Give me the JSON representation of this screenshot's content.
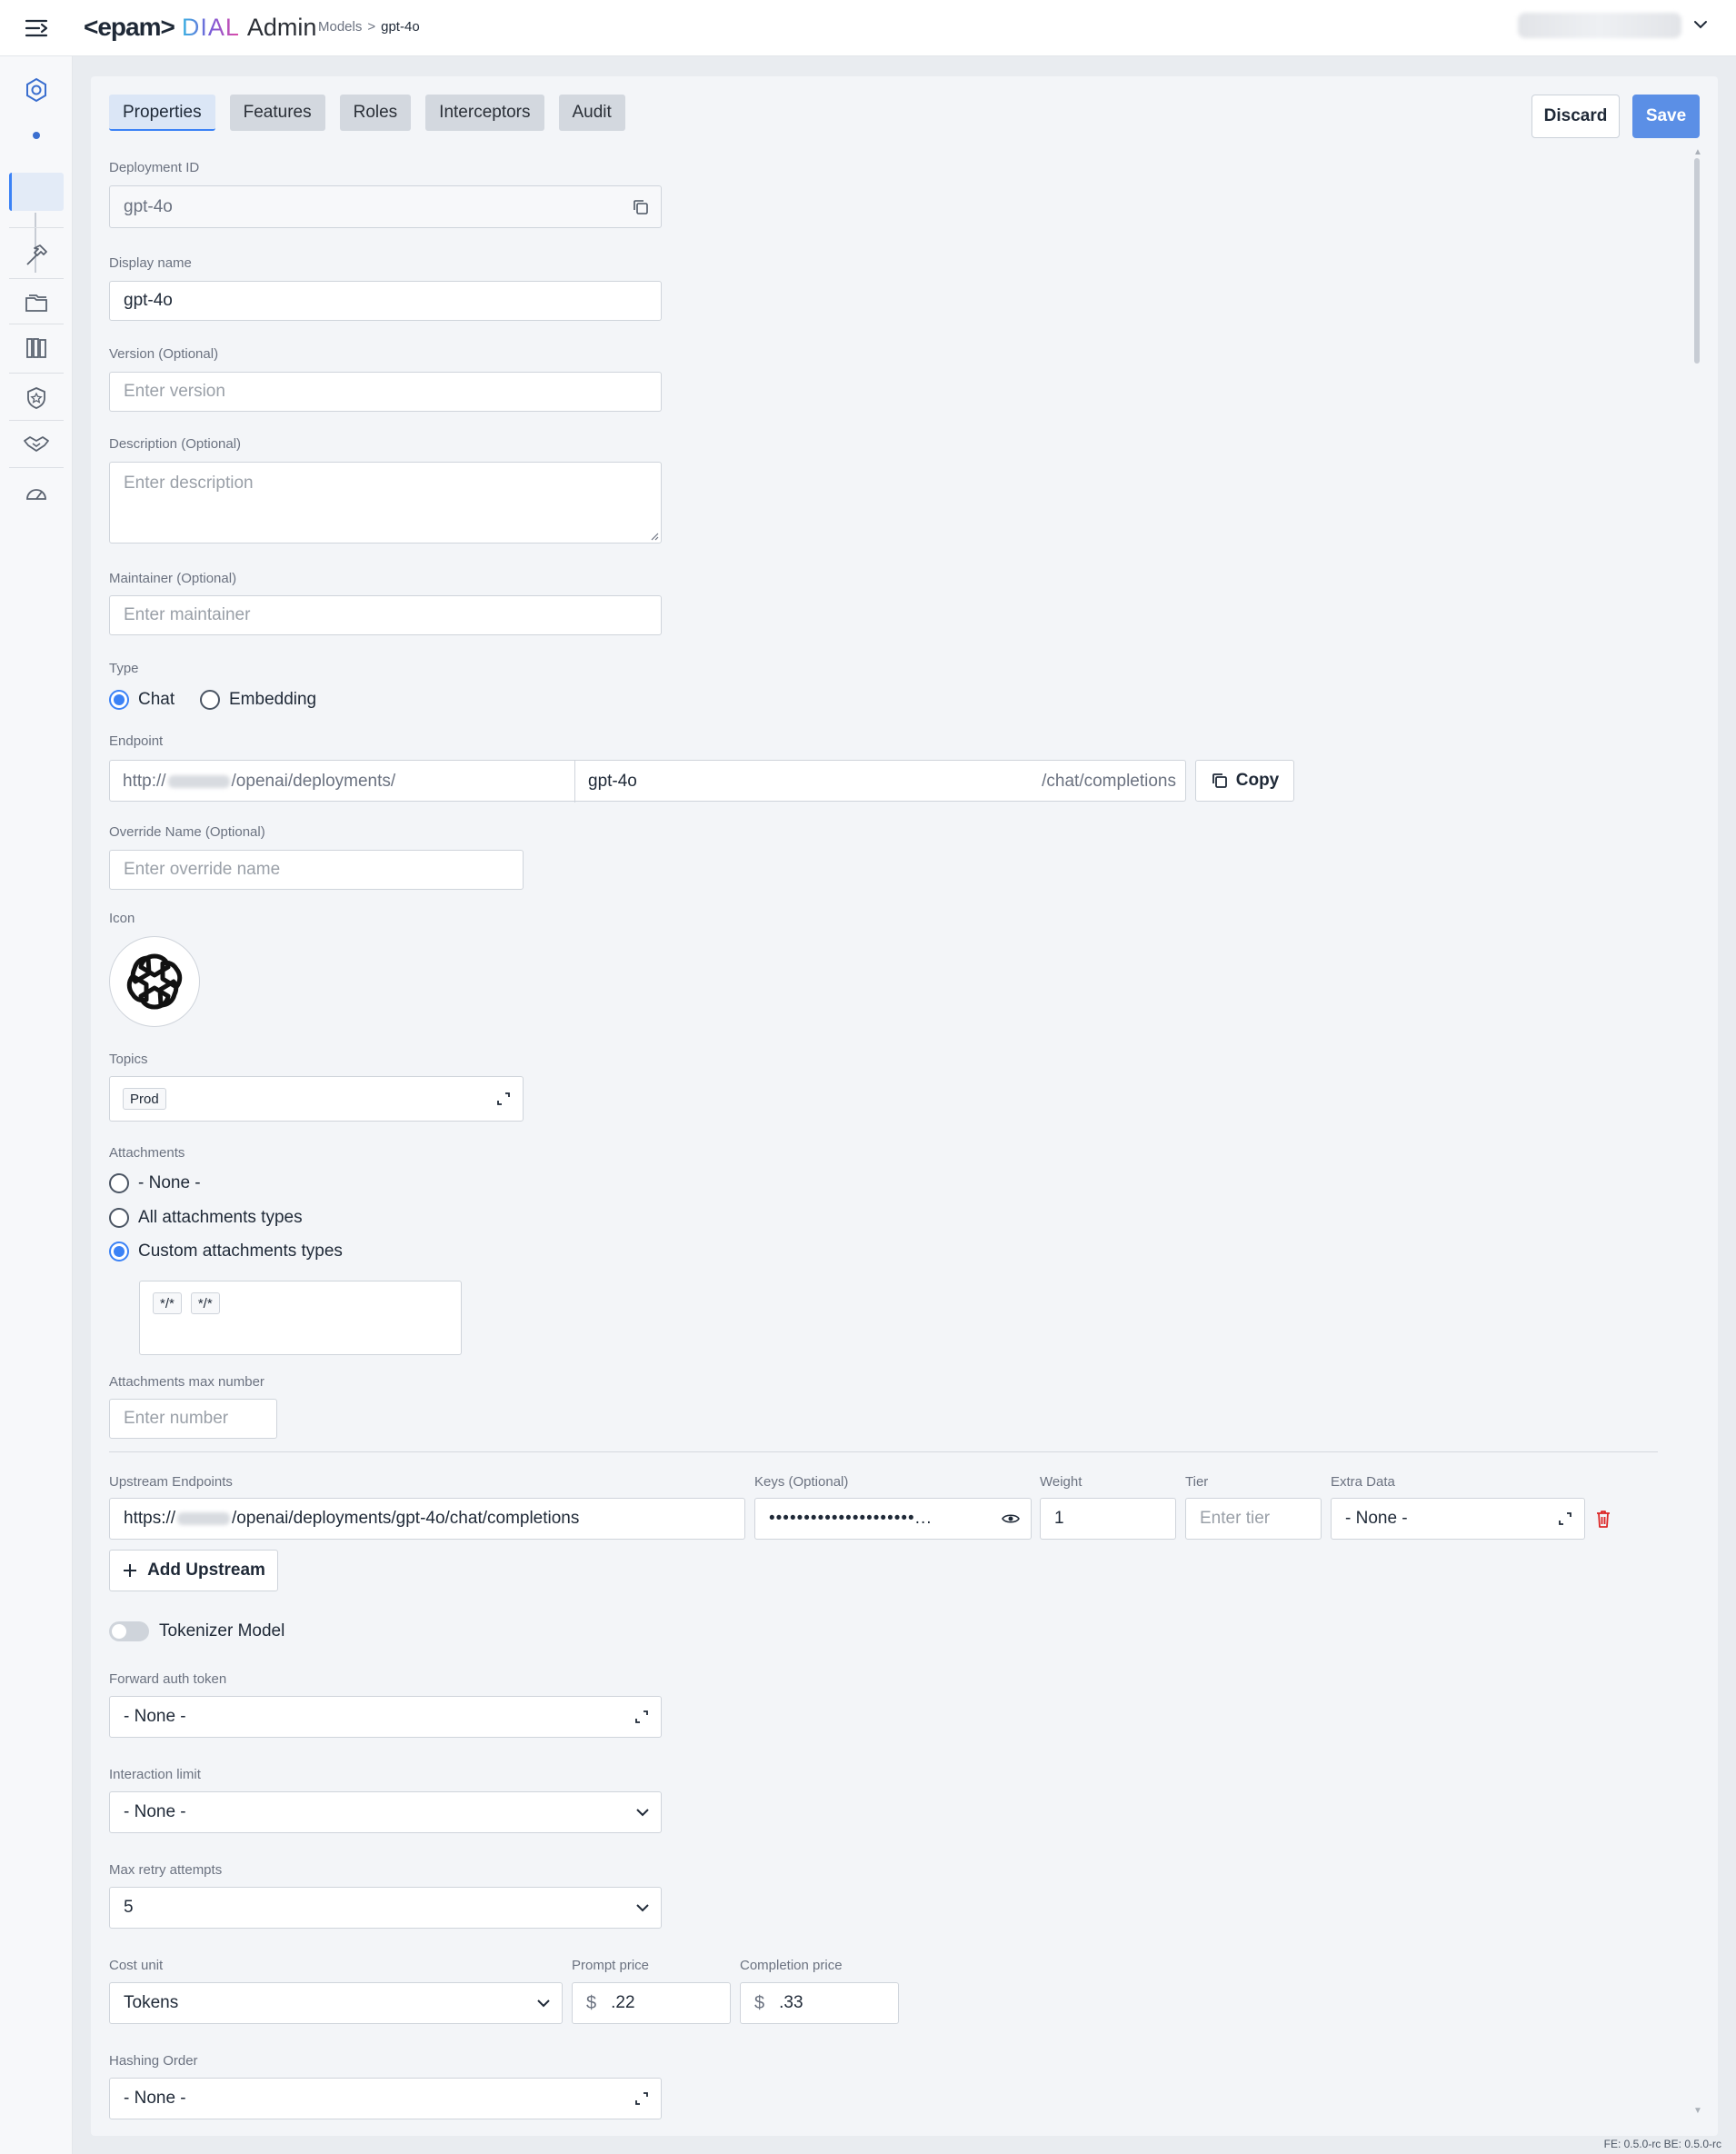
{
  "header": {
    "logo_epam": "<epam>",
    "logo_dial": "DIAL",
    "logo_admin": "Admin",
    "breadcrumb_parent": "Models",
    "breadcrumb_sep": ">",
    "breadcrumb_current": "gpt-4o"
  },
  "tabs": [
    {
      "label": "Properties"
    },
    {
      "label": "Features"
    },
    {
      "label": "Roles"
    },
    {
      "label": "Interceptors"
    },
    {
      "label": "Audit"
    }
  ],
  "actions": {
    "discard": "Discard",
    "save": "Save"
  },
  "form": {
    "deployment_id": {
      "label": "Deployment ID",
      "value": "gpt-4o"
    },
    "display_name": {
      "label": "Display name",
      "value": "gpt-4o"
    },
    "version": {
      "label": "Version (Optional)",
      "placeholder": "Enter version"
    },
    "description": {
      "label": "Description (Optional)",
      "placeholder": "Enter description"
    },
    "maintainer": {
      "label": "Maintainer (Optional)",
      "placeholder": "Enter maintainer"
    },
    "type": {
      "label": "Type",
      "options": [
        "Chat",
        "Embedding"
      ],
      "selected": "Chat"
    },
    "endpoint": {
      "label": "Endpoint",
      "prefix_start": "http://",
      "prefix_end": "/openai/deployments/",
      "model": "gpt-4o",
      "suffix": "/chat/completions",
      "copy_label": "Copy"
    },
    "override_name": {
      "label": "Override Name (Optional)",
      "placeholder": "Enter override name"
    },
    "icon": {
      "label": "Icon",
      "name": "openai-logo-icon"
    },
    "topics": {
      "label": "Topics",
      "chips": [
        "Prod"
      ]
    },
    "attachments": {
      "label": "Attachments",
      "options": [
        "- None -",
        "All attachments types",
        "Custom attachments types"
      ],
      "selected": "Custom attachments types",
      "custom_types": [
        "*/*",
        "*/*"
      ]
    },
    "attachments_max": {
      "label": "Attachments max number",
      "placeholder": "Enter number"
    },
    "upstream": {
      "headers": {
        "endpoints": "Upstream Endpoints",
        "keys": "Keys (Optional)",
        "weight": "Weight",
        "tier": "Tier",
        "extra": "Extra Data"
      },
      "rows": [
        {
          "url_start": "https://",
          "url_end": "/openai/deployments/gpt-4o/chat/completions",
          "key_mask": "•••••••••••••••••••••...",
          "weight": "1",
          "tier_placeholder": "Enter tier",
          "extra": "- None -"
        }
      ],
      "add_label": "Add Upstream"
    },
    "tokenizer": {
      "label": "Tokenizer Model",
      "enabled": false
    },
    "forward_auth": {
      "label": "Forward auth token",
      "value": "- None -"
    },
    "interaction_limit": {
      "label": "Interaction limit",
      "value": "- None -"
    },
    "max_retry": {
      "label": "Max retry attempts",
      "value": "5"
    },
    "cost_unit": {
      "label": "Cost unit",
      "value": "Tokens"
    },
    "prompt_price": {
      "label": "Prompt price",
      "currency": "$",
      "value": ".22"
    },
    "completion_price": {
      "label": "Completion price",
      "currency": "$",
      "value": ".33"
    },
    "hashing_order": {
      "label": "Hashing Order",
      "value": "- None -"
    }
  },
  "footer": {
    "version": "FE: 0.5.0-rc BE: 0.5.0-rc"
  },
  "colors": {
    "accent": "#3b82f6",
    "save_bg": "#5b8fe6",
    "danger": "#dc2626"
  }
}
